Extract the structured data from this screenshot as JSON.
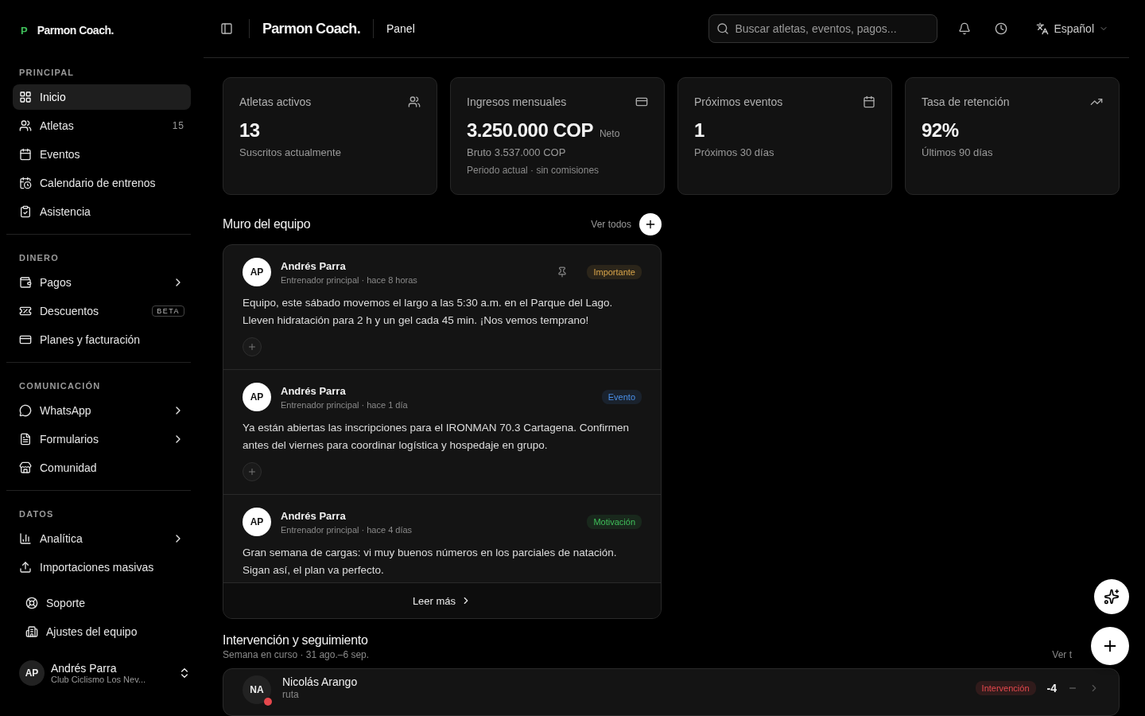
{
  "brand": {
    "mark": "P",
    "name": "Parmon Coach."
  },
  "sidebar": {
    "sections": [
      {
        "label": "PRINCIPAL",
        "items": [
          {
            "label": "Inicio",
            "selected": true,
            "has_submenu": false
          },
          {
            "label": "Atletas",
            "selected": false,
            "has_submenu": false,
            "count": "15"
          },
          {
            "label": "Eventos",
            "selected": false,
            "has_submenu": false
          },
          {
            "label": "Calendario de entrenos",
            "selected": false,
            "has_submenu": false
          },
          {
            "label": "Asistencia",
            "selected": false,
            "has_submenu": false
          }
        ]
      },
      {
        "label": "DINERO",
        "items": [
          {
            "label": "Pagos",
            "selected": false,
            "has_submenu": true
          },
          {
            "label": "Descuentos",
            "selected": false,
            "has_submenu": false,
            "badge": "BETA"
          },
          {
            "label": "Planes y facturación",
            "selected": false,
            "has_submenu": false
          }
        ]
      },
      {
        "label": "COMUNICACIÓN",
        "items": [
          {
            "label": "WhatsApp",
            "selected": false,
            "has_submenu": true
          },
          {
            "label": "Formularios",
            "selected": false,
            "has_submenu": true
          },
          {
            "label": "Comunidad",
            "selected": false,
            "has_submenu": false
          }
        ]
      },
      {
        "label": "DATOS",
        "items": [
          {
            "label": "Analítica",
            "selected": false,
            "has_submenu": true
          },
          {
            "label": "Importaciones masivas",
            "selected": false,
            "has_submenu": false
          }
        ]
      }
    ],
    "footer_links": [
      "Soporte",
      "Ajustes del equipo"
    ],
    "user": {
      "initials": "AP",
      "name": "Andrés Parra",
      "club": "Club Ciclismo Los Nev..."
    }
  },
  "header": {
    "brand": "Parmon Coach.",
    "page": "Panel",
    "search": {
      "placeholder": "Buscar atletas, eventos, pagos..."
    },
    "language": "Español"
  },
  "stats": [
    {
      "title": "Atletas activos",
      "value": "13",
      "subtitle": "Suscritos actualmente"
    },
    {
      "title": "Ingresos mensuales",
      "value": "3.250.000 COP",
      "value_note": "Neto",
      "subtitle": "Bruto 3.537.000 COP",
      "footnote": "Periodo actual · sin comisiones"
    },
    {
      "title": "Próximos eventos",
      "value": "1",
      "subtitle": "Próximos 30 días"
    },
    {
      "title": "Tasa de retención",
      "value": "92%",
      "subtitle": "Últimos 90 días"
    }
  ],
  "wall": {
    "title": "Muro del equipo",
    "see_all": "Ver todos",
    "posts": [
      {
        "initials": "AP",
        "author": "Andrés Parra",
        "meta": "Entrenador principal · hace 8 horas",
        "pinned": true,
        "tag": "Importante",
        "color": "#d9a54a",
        "text": "Equipo, este sábado movemos el largo a las 5:30 a.m. en el Parque del Lago. Lleven hidratación para 2 h y un gel cada 45 min. ¡Nos vemos temprano!",
        "reactions": true
      },
      {
        "initials": "AP",
        "author": "Andrés Parra",
        "meta": "Entrenador principal · hace 1 día",
        "pinned": false,
        "tag": "Evento",
        "color": "#4a8fe8",
        "text": "Ya están abiertas las inscripciones para el IRONMAN 70.3 Cartagena. Confirmen antes del viernes para coordinar logística y hospedaje en grupo.",
        "reactions": true
      },
      {
        "initials": "AP",
        "author": "Andrés Parra",
        "meta": "Entrenador principal · hace 4 días",
        "pinned": false,
        "tag": "Motivación",
        "color": "#3fbf5a",
        "text": "Gran semana de cargas: vi muy buenos números en los parciales de natación. Sigan así, el plan va perfecto.",
        "reactions": false
      }
    ],
    "read_more": "Leer más"
  },
  "followup": {
    "title": "Intervención y seguimiento",
    "subtitle": "Semana en curso · 31 ago.–6 sep.",
    "see_all": "Ver t",
    "rows": [
      {
        "initials": "NA",
        "name": "Nicolás Arango",
        "detail": "ruta",
        "alert": true,
        "status": "Intervención",
        "score": "-4"
      }
    ]
  }
}
